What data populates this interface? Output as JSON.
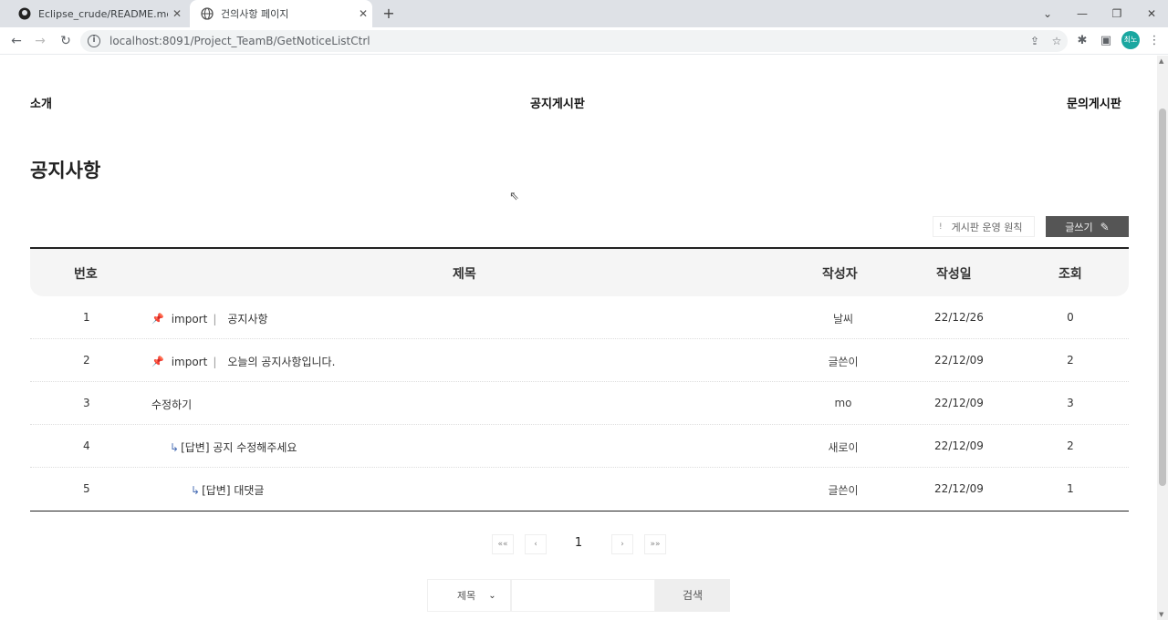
{
  "browser": {
    "tabs": [
      {
        "title": "Eclipse_crude/README.md at m",
        "icon": "github-icon"
      },
      {
        "title": "건의사항 페이지",
        "icon": "globe-icon"
      }
    ],
    "new_tab": "+",
    "url": "localhost:8091/Project_TeamB/GetNoticeListCtrl",
    "avatar": "최노"
  },
  "nav": {
    "intro": "소개",
    "notice": "공지게시판",
    "inquiry": "문의게시판"
  },
  "page_title": "공지사항",
  "buttons": {
    "rules": "게시판 운영 원칙",
    "rules_icon": "!",
    "write": "글쓰기"
  },
  "table": {
    "headers": {
      "num": "번호",
      "title": "제목",
      "author": "작성자",
      "date": "작성일",
      "views": "조회"
    },
    "rows": [
      {
        "num": "1",
        "pinned": true,
        "tag": "import",
        "sep": "|",
        "title": "공지사항",
        "author": "날씨",
        "date": "22/12/26",
        "views": "0"
      },
      {
        "num": "2",
        "pinned": true,
        "tag": "import",
        "sep": "|",
        "title": "오늘의 공지사항입니다.",
        "author": "글쓴이",
        "date": "22/12/09",
        "views": "2"
      },
      {
        "num": "3",
        "title": "수정하기",
        "author": "mo",
        "date": "22/12/09",
        "views": "3"
      },
      {
        "num": "4",
        "reply": "↳",
        "title": "[답변] 공지 수정해주세요",
        "author": "새로이",
        "date": "22/12/09",
        "views": "2"
      },
      {
        "num": "5",
        "reply": "↳",
        "title": "[답변] 대댓글",
        "author": "글쓴이",
        "date": "22/12/09",
        "views": "1"
      }
    ]
  },
  "pagination": {
    "first": "««",
    "prev": "‹",
    "current": "1",
    "next": "›",
    "last": "»»"
  },
  "search": {
    "field": "제목",
    "button": "검색"
  }
}
